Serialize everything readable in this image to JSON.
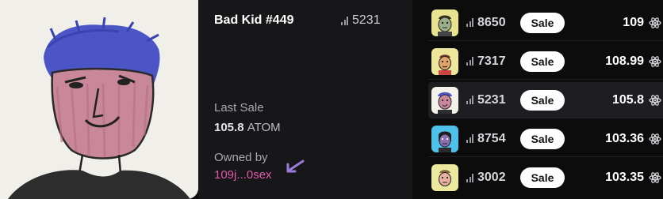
{
  "nft": {
    "name": "Bad Kid #449",
    "rank": "5231"
  },
  "sale": {
    "last_label": "Last Sale",
    "last_price": "105.8",
    "last_unit": "ATOM",
    "owned_label": "Owned by",
    "owner": "109j...0sex"
  },
  "listings": [
    {
      "rank": "8650",
      "button": "Sale",
      "price": "109",
      "thumb_bg": "#e8e38f"
    },
    {
      "rank": "7317",
      "button": "Sale",
      "price": "108.99",
      "thumb_bg": "#ece79a"
    },
    {
      "rank": "5231",
      "button": "Sale",
      "price": "105.8",
      "thumb_bg": "#f3f1ea",
      "selected": true
    },
    {
      "rank": "8754",
      "button": "Sale",
      "price": "103.36",
      "thumb_bg": "#4dc1e9"
    },
    {
      "rank": "3002",
      "button": "Sale",
      "price": "103.35",
      "thumb_bg": "#ece89d"
    }
  ],
  "colors": {
    "owner_link": "#e05aa9",
    "arrow": "#9b7bd8",
    "sale_button": "#ffffff"
  }
}
